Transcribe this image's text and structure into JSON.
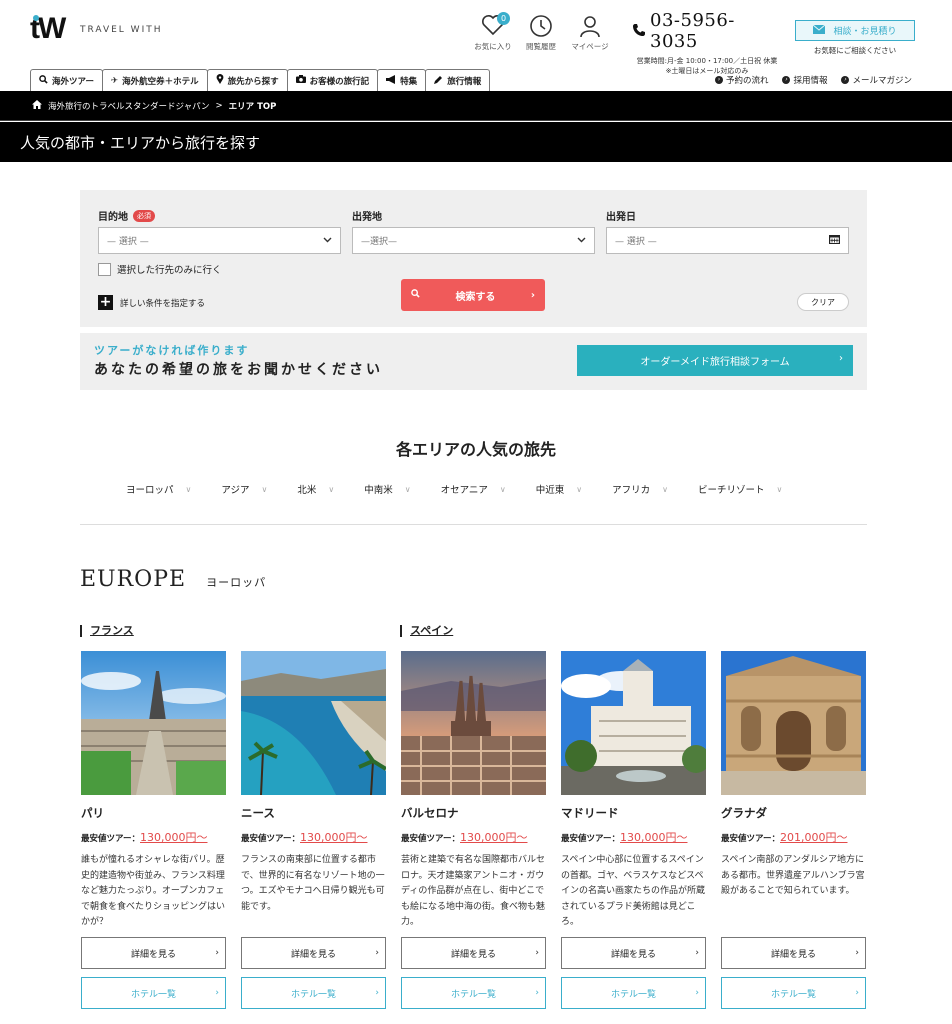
{
  "header": {
    "logo_text": "TRAVEL WITH",
    "favorites_label": "お気に入り",
    "favorites_count": "0",
    "history_label": "閲覧履歴",
    "mypage_label": "マイページ",
    "phone": "03-5956-3035",
    "hours_line1": "営業時間:月-金 10:00・17:00／土日祝 休業",
    "hours_line2": "※土曜日はメール対応のみ",
    "cta_label": "相談・お見積り",
    "cta_sub": "お気軽にご相談ください"
  },
  "nav": {
    "tabs": [
      {
        "label": "海外ツアー",
        "icon": "search-icon"
      },
      {
        "label": "海外航空券＋ホテル",
        "icon": "plane-icon"
      },
      {
        "label": "旅先から探す",
        "icon": "pin-icon"
      },
      {
        "label": "お客様の旅行記",
        "icon": "camera-icon"
      },
      {
        "label": "特集",
        "icon": "megaphone-icon"
      },
      {
        "label": "旅行情報",
        "icon": "pen-icon"
      }
    ],
    "sub": [
      "予約の流れ",
      "採用情報",
      "メールマガジン"
    ]
  },
  "breadcrumb": {
    "home": "海外旅行のトラベルスタンダードジャパン",
    "sep": ">",
    "current": "エリア TOP"
  },
  "page_title": "人気の都市・エリアから旅行を探す",
  "search": {
    "dest_label": "目的地",
    "required": "必須",
    "dest_placeholder": "— 選択 —",
    "dep_label": "出発地",
    "dep_placeholder": "—選択—",
    "date_label": "出発日",
    "date_placeholder": "— 選択 —",
    "only_checkbox": "選択した行先のみに行く",
    "more": "詳しい条件を指定する",
    "search_button": "検索する",
    "clear_button": "クリア"
  },
  "ordermade": {
    "line1": "ツアーがなければ作ります",
    "line2": "あなたの希望の旅をお聞かせください",
    "button": "オーダーメイド旅行相談フォーム"
  },
  "areas_title": "各エリアの人気の旅先",
  "areas": [
    "ヨーロッパ",
    "アジア",
    "北米",
    "中南米",
    "オセアニア",
    "中近東",
    "アフリカ",
    "ビーチリゾート"
  ],
  "region": {
    "en": "EUROPE",
    "ja": "ヨーロッパ"
  },
  "countries": [
    "フランス",
    "スペイン"
  ],
  "price_label": "最安値ツアー：",
  "details_button": "詳細を見る",
  "hotel_button": "ホテル一覧",
  "cities": [
    {
      "name": "パリ",
      "price": "130,000円〜",
      "desc": "誰もが憧れるオシャレな街パリ。歴史的建造物や街並み、フランス料理など魅力たっぷり。オープンカフェで朝食を食べたりショッピングはいかが？"
    },
    {
      "name": "ニース",
      "price": "130,000円〜",
      "desc": "フランスの南東部に位置する都市で、世界的に有名なリゾート地の一つ。エズやモナコへ日帰り観光も可能です。"
    },
    {
      "name": "バルセロナ",
      "price": "130,000円〜",
      "desc": "芸術と建築で有名な国際都市バルセロナ。天才建築家アントニオ・ガウディの作品群が点在し、街中どこでも絵になる地中海の街。食べ物も魅力。"
    },
    {
      "name": "マドリード",
      "price": "130,000円〜",
      "desc": "スペイン中心部に位置するスペインの首都。ゴヤ、ベラスケスなどスペインの名高い画家たちの作品が所蔵されているプラド美術館は見どころ。"
    },
    {
      "name": "グラナダ",
      "price": "201,000円〜",
      "desc": "スペイン南部のアンダルシア地方にある都市。世界遺産アルハンブラ宮殿があることで知られています。"
    }
  ]
}
